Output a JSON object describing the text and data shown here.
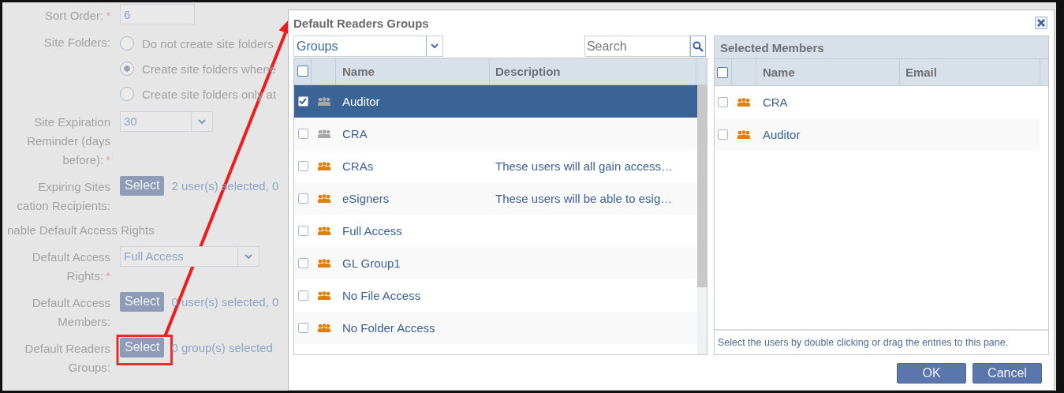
{
  "form": {
    "rows": [
      {
        "kind": "text",
        "label_lines": [
          "Sort Order:"
        ],
        "required_mark": "*",
        "value": "6"
      },
      {
        "kind": "radios",
        "label_lines": [
          "Site Folders:"
        ],
        "options": [
          {
            "label": "Do not create site folders",
            "selected": false
          },
          {
            "label": "Create site folders whene",
            "selected": true
          },
          {
            "label": "Create site folders only at",
            "selected": false
          }
        ]
      },
      {
        "kind": "dropdown",
        "label_lines": [
          "Site Expiration",
          "Reminder (days",
          "before):"
        ],
        "required_mark": "*",
        "value": "30"
      },
      {
        "kind": "picker",
        "label_lines": [
          "Expiring Sites",
          "cation Recipients:"
        ],
        "button": "Select",
        "summary": "2 user(s) selected, 0"
      },
      {
        "kind": "heading",
        "text": "nable Default Access Rights"
      },
      {
        "kind": "dropdown",
        "label_lines": [
          "Default Access",
          "Rights:"
        ],
        "required_mark": "*",
        "value": "Full Access"
      },
      {
        "kind": "picker",
        "label_lines": [
          "Default Access",
          "Members:"
        ],
        "button": "Select",
        "summary": "0 user(s) selected, 0"
      },
      {
        "kind": "picker",
        "label_lines": [
          "Default Readers",
          "Groups:"
        ],
        "button": "Select",
        "summary": "0 group(s) selected",
        "highlighted": true
      }
    ]
  },
  "dialog": {
    "title": "Default Readers Groups",
    "source": {
      "value": "Groups",
      "search_placeholder": "Search",
      "all_checked": false,
      "columns": [
        "Name",
        "Description"
      ],
      "rows": [
        {
          "name": "Auditor",
          "description": "",
          "checked": true,
          "selected": true,
          "color": "#a8a8a8"
        },
        {
          "name": "CRA",
          "description": "",
          "checked": false,
          "selected": false,
          "color": "#a8a8a8"
        },
        {
          "name": "CRAs",
          "description": "These users will all gain access…",
          "checked": false,
          "selected": false,
          "color": "#e07f10"
        },
        {
          "name": "eSigners",
          "description": "These users will be able to esig…",
          "checked": false,
          "selected": false,
          "color": "#e07f10"
        },
        {
          "name": "Full Access",
          "description": "",
          "checked": false,
          "selected": false,
          "color": "#e07f10"
        },
        {
          "name": "GL Group1",
          "description": "",
          "checked": false,
          "selected": false,
          "color": "#e07f10"
        },
        {
          "name": "No File Access",
          "description": "",
          "checked": false,
          "selected": false,
          "color": "#e07f10"
        },
        {
          "name": "No Folder Access",
          "description": "",
          "checked": false,
          "selected": false,
          "color": "#e07f10"
        }
      ]
    },
    "selected": {
      "title": "Selected Members",
      "columns": [
        "Name",
        "Email"
      ],
      "all_checked": false,
      "rows": [
        {
          "name": "CRA",
          "email": "",
          "checked": false,
          "color": "#e07f10"
        },
        {
          "name": "Auditor",
          "email": "",
          "checked": false,
          "color": "#e07f10"
        }
      ],
      "hint": "Select the users by double clicking or drag the entries to this pane."
    },
    "buttons": [
      "OK",
      "Cancel"
    ]
  }
}
